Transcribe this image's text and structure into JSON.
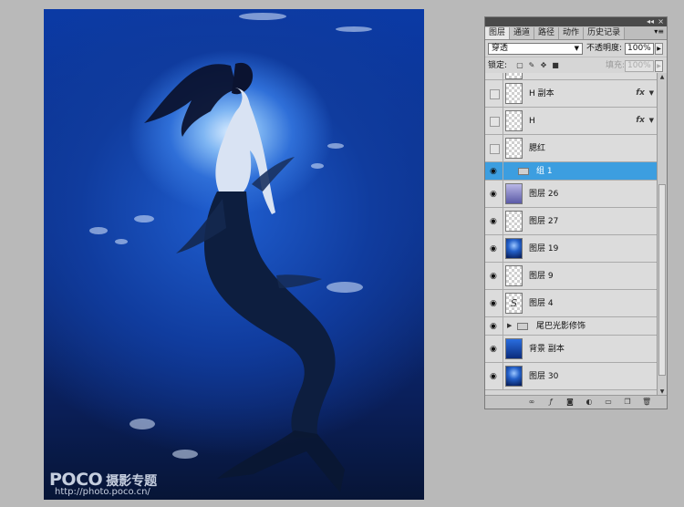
{
  "canvas": {
    "watermark": "POCO",
    "watermark_sub": "摄影专题",
    "watermark_url": "http://photo.poco.cn/"
  },
  "panel": {
    "tabs": [
      "图层",
      "通道",
      "路径",
      "动作",
      "历史记录"
    ],
    "active_tab": "图层",
    "blend_mode": "穿透",
    "opacity_label": "不透明度:",
    "opacity_value": "100%",
    "lock_label": "锁定:",
    "fill_label": "填充:",
    "fill_value": "100%",
    "layers": [
      {
        "name": "",
        "visible": false,
        "thumb": "transparent",
        "kind": "partial"
      },
      {
        "name": "H 副本",
        "visible": false,
        "thumb": "transparent",
        "fx": "fx"
      },
      {
        "name": "H",
        "visible": false,
        "thumb": "transparent",
        "fx": "fx"
      },
      {
        "name": "腮红",
        "visible": false,
        "thumb": "transparent"
      },
      {
        "name": "组 1",
        "visible": true,
        "kind": "group",
        "selected": true
      },
      {
        "name": "图层 26",
        "visible": true,
        "thumb": "violet"
      },
      {
        "name": "图层 27",
        "visible": true,
        "thumb": "transparent"
      },
      {
        "name": "图层 19",
        "visible": true,
        "thumb": "pic"
      },
      {
        "name": "图层 9",
        "visible": true,
        "thumb": "transparent"
      },
      {
        "name": "图层 4",
        "visible": true,
        "thumb": "sketch"
      },
      {
        "name": "尾巴光影修饰",
        "visible": true,
        "kind": "group"
      },
      {
        "name": "背景 副本",
        "visible": true,
        "thumb": "blue"
      },
      {
        "name": "图层 30",
        "visible": true,
        "thumb": "pic"
      }
    ]
  },
  "colors": {
    "selected_row": "#3c9ee0",
    "panel_bg": "#d6d6d6",
    "workspace_bg": "#b9b9b9"
  }
}
